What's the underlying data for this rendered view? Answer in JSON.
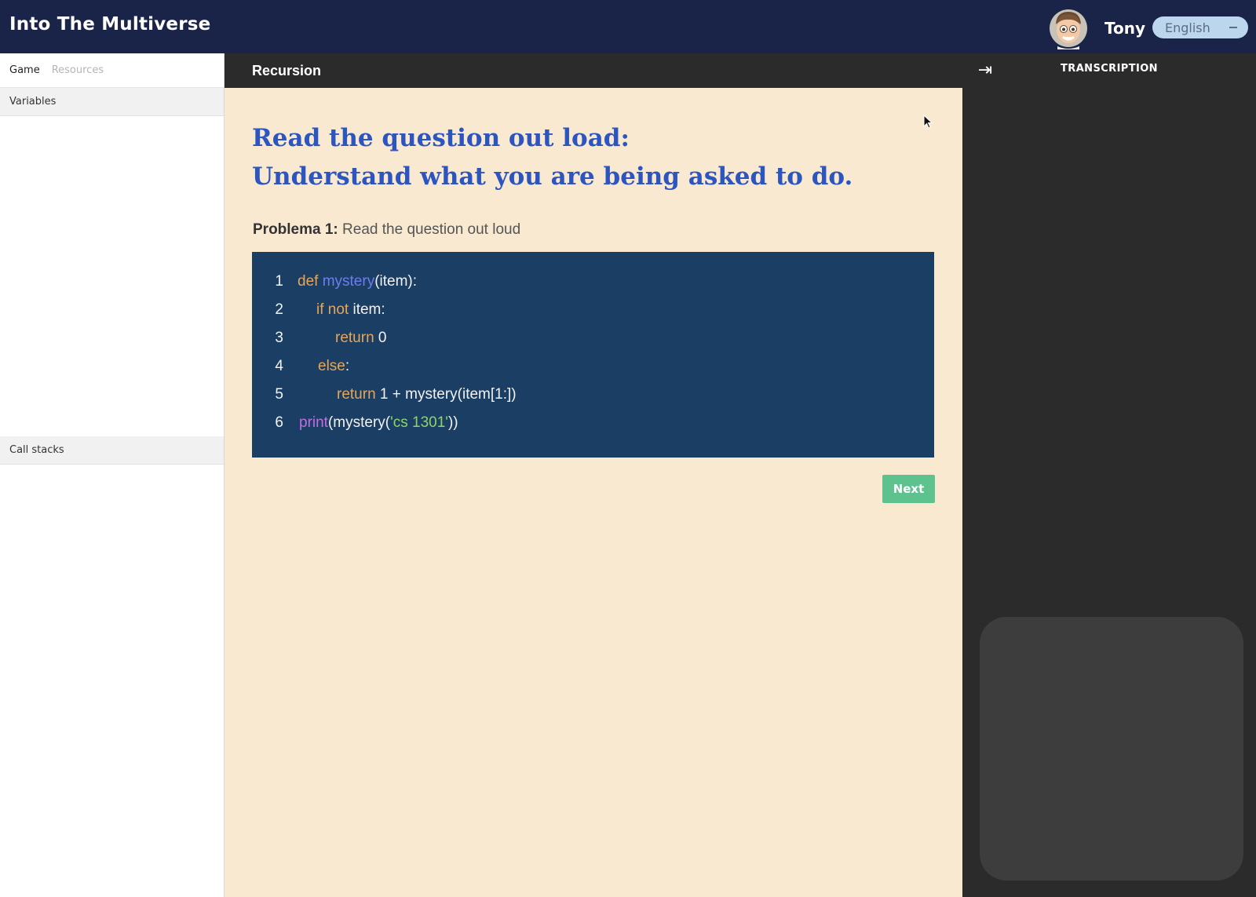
{
  "app": {
    "title": "Into The Multiverse",
    "user_name": "Tony",
    "language": "English"
  },
  "sidebar": {
    "tabs": [
      {
        "label": "Game",
        "active": true
      },
      {
        "label": "Resources",
        "active": false
      }
    ],
    "variables_label": "Variables",
    "call_stacks_label": "Call stacks"
  },
  "main": {
    "section_title": "Recursion",
    "heading_line1": "Read the question out load:",
    "heading_line2": "Understand what you are being asked to do.",
    "problem_label": "Problema 1:",
    "problem_text": "Read the question out loud",
    "code_lines": [
      {
        "num": "1"
      },
      {
        "num": "2"
      },
      {
        "num": "3"
      },
      {
        "num": "4"
      },
      {
        "num": "5"
      },
      {
        "num": "6"
      }
    ],
    "code_tokens": {
      "l1_def": "def",
      "l1_fn": "mystery",
      "l1_rest": "(item):",
      "l2_if": "if not",
      "l2_rest": " item:",
      "l3_return": "return",
      "l3_rest": " 0",
      "l4_else": "else",
      "l4_rest": ":",
      "l5_return": "return",
      "l5_rest": " 1 + mystery(item[1:])",
      "l6_print": "print",
      "l6_mid": "(mystery(",
      "l6_str": "'cs 1301'",
      "l6_end": "))"
    },
    "next_label": "Next"
  },
  "right_panel": {
    "title": "TRANSCRIPTION"
  },
  "colors": {
    "topbar": "#1a2348",
    "content_bg": "#f8e9d0",
    "heading": "#2c55c0",
    "code_bg": "#1b3f64",
    "next_button": "#5ec28f",
    "right_panel": "#2b2b2b"
  },
  "icons": {
    "collapse": "arrow-to-right-icon",
    "avatar": "memoji-avatar",
    "language_dropdown": "chevron-down-icon"
  }
}
